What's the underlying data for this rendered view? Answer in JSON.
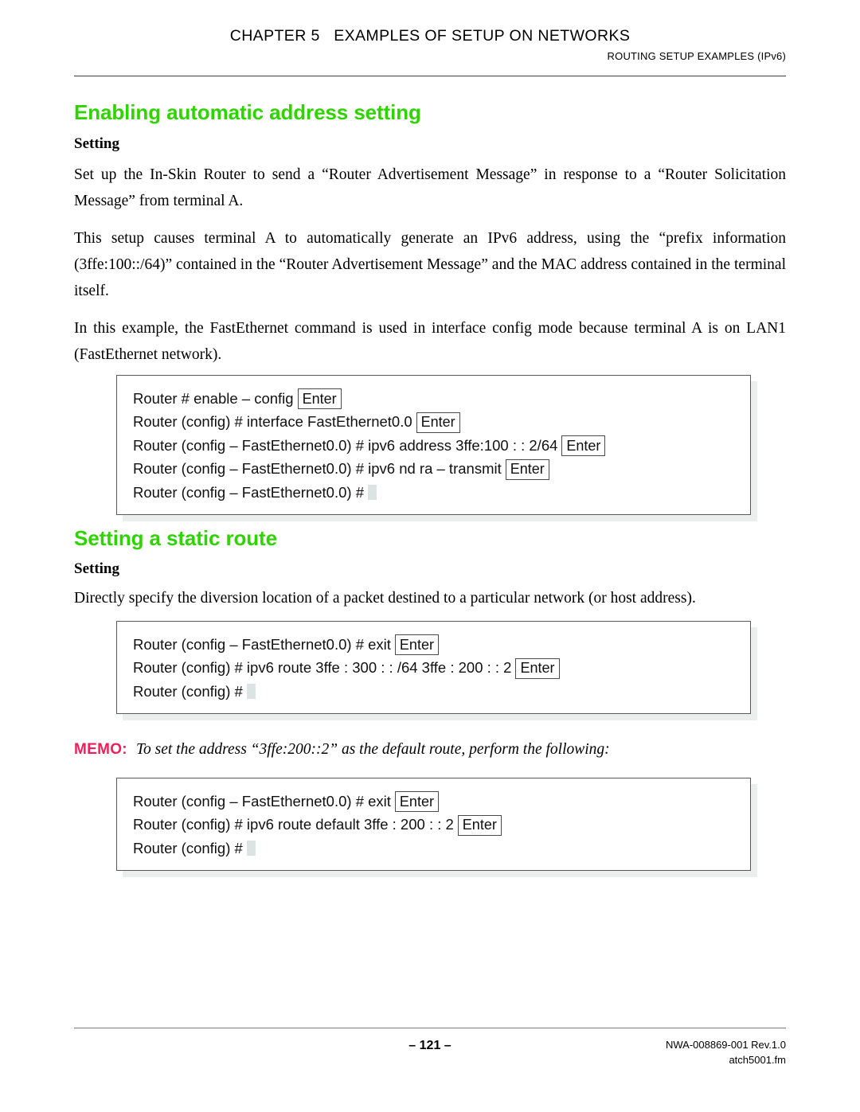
{
  "header": {
    "chapter": "CHAPTER 5   EXAMPLES OF SETUP ON NETWORKS",
    "subtitle": "ROUTING SETUP EXAMPLES (IPv6)"
  },
  "section1": {
    "heading": "Enabling automatic address setting",
    "subheading": "Setting",
    "paragraphs": [
      "Set up the In-Skin Router to send a “Router Advertisement Message” in response to a “Router Solicitation Message” from terminal A.",
      "This setup causes terminal A to automatically generate an IPv6 address, using the “prefix information (3ffe:100::/64)” contained in the “Router Advertisement Message” and the MAC address contained in the terminal itself.",
      "In this example, the FastEthernet command is used in interface config mode because terminal A is on LAN1 (FastEthernet network)."
    ],
    "console": {
      "lines": [
        {
          "text": "Router # enable – config",
          "enter": "Enter",
          "cursor": false
        },
        {
          "text": "Router (config) # interface FastEthernet0.0",
          "enter": "Enter",
          "cursor": false
        },
        {
          "text": "Router (config – FastEthernet0.0) # ipv6 address 3ffe:100 : : 2/64",
          "enter": "Enter",
          "cursor": false
        },
        {
          "text": "Router (config – FastEthernet0.0) # ipv6 nd ra – transmit",
          "enter": "Enter",
          "cursor": false
        },
        {
          "text": "Router (config – FastEthernet0.0) #",
          "enter": null,
          "cursor": true
        }
      ]
    }
  },
  "section2": {
    "heading": "Setting a static route",
    "subheading": "Setting",
    "paragraphs": [
      "Directly specify the diversion location of a packet destined to a particular network (or host address)."
    ],
    "console": {
      "lines": [
        {
          "text": "Router (config – FastEthernet0.0) # exit",
          "enter": "Enter",
          "cursor": false
        },
        {
          "text": "Router (config) # ipv6 route 3ffe : 300 : : /64 3ffe : 200 : : 2",
          "enter": "Enter",
          "cursor": false
        },
        {
          "text": "Router (config) #",
          "enter": null,
          "cursor": true
        }
      ]
    }
  },
  "memo": {
    "label": "MEMO:",
    "text": "To set the address “3ffe:200::2” as the default route, perform the following:",
    "console": {
      "lines": [
        {
          "text": "Router (config – FastEthernet0.0) # exit",
          "enter": "Enter",
          "cursor": false
        },
        {
          "text": "Router (config) # ipv6 route default 3ffe : 200 : : 2",
          "enter": "Enter",
          "cursor": false
        },
        {
          "text": "Router (config) #",
          "enter": null,
          "cursor": true
        }
      ]
    }
  },
  "footer": {
    "page_number": "– 121 –",
    "doc_number": "NWA-008869-001 Rev.1.0",
    "file_name": "atch5001.fm"
  },
  "colors": {
    "heading_green": "#2FD400",
    "memo_pink": "#EF1F59",
    "box_border": "#595959",
    "box_shadow": "#ECEEEE",
    "cursor": "#DCE3E3"
  }
}
